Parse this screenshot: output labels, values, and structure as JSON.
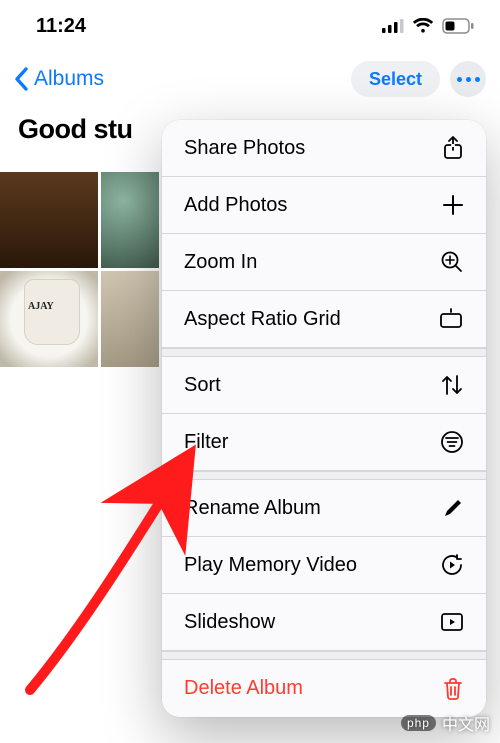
{
  "status": {
    "time": "11:24"
  },
  "nav": {
    "back_label": "Albums",
    "select_label": "Select"
  },
  "page": {
    "title_truncated": "Good stu"
  },
  "photo_cup_label": "AJAY",
  "menu": {
    "share": "Share Photos",
    "add": "Add Photos",
    "zoom": "Zoom In",
    "grid": "Aspect Ratio Grid",
    "sort": "Sort",
    "filter": "Filter",
    "rename": "Rename Album",
    "play": "Play Memory Video",
    "slide": "Slideshow",
    "delete": "Delete Album"
  },
  "watermark": {
    "badge": "php",
    "text": "中文网"
  }
}
